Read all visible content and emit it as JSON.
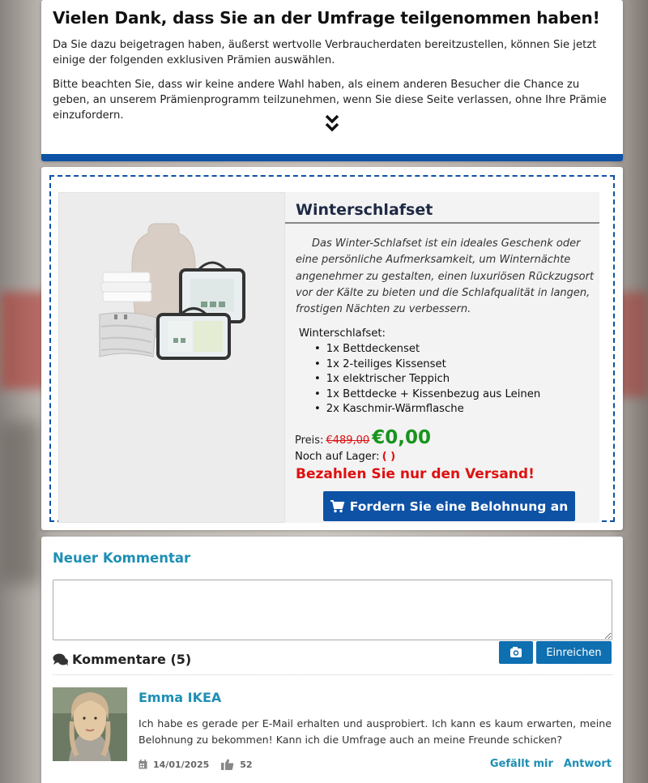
{
  "intro": {
    "title": "Vielen Dank, dass Sie an der Umfrage teilgenommen haben!",
    "paragraph1": "Da Sie dazu beigetragen haben, äußerst wertvolle Verbraucherdaten bereitzustellen, können Sie jetzt einige der folgenden exklusiven Prämien auswählen.",
    "paragraph2": "Bitte beachten Sie, dass wir keine andere Wahl haben, als einem anderen Besucher die Chance zu geben, an unserem Prämienprogramm teilzunehmen, wenn Sie diese Seite verlassen, ohne Ihre Prämie einzufordern.",
    "scroll_icon": "double-chevron-down-icon"
  },
  "offer": {
    "title": "Winterschlafset",
    "description": "Das Winter-Schlafset ist ein ideales Geschenk oder eine persönliche Aufmerksamkeit, um Winternächte angenehmer zu gestalten, einen luxuriösen Rückzugsort vor der Kälte zu bieten und die Schlafqualität in langen, frostigen Nächten zu verbessern.",
    "includes_label": "Winterschlafset:",
    "items": [
      "1x Bettdeckenset",
      "1x 2-teiliges Kissenset",
      "1x elektrischer Teppich",
      "1x Bettdecke + Kissenbezug aus Leinen",
      "2x Kaschmir-Wärmflasche"
    ],
    "price_label": "Preis:",
    "old_price": "€489,00",
    "new_price": "€0,00",
    "stock_label": "Noch auf Lager:",
    "stock_value": "(    )",
    "shipping_note": "Bezahlen Sie nur den Versand!",
    "cta_label": "Fordern Sie eine Belohnung an",
    "cta_icon": "shopping-cart-icon"
  },
  "comments": {
    "new_comment_title": "Neuer Kommentar",
    "submit_label": "Einreichen",
    "camera_icon": "camera-icon",
    "count_label": "Kommentare (5)",
    "list": [
      {
        "author": "Emma IKEA",
        "text": "Ich habe es gerade per E-Mail erhalten und ausprobiert. Ich kann es kaum erwarten, meine Belohnung zu bekommen! Kann ich die Umfrage auch an meine Freunde schicken?",
        "date": "14/01/2025",
        "likes": "52",
        "like_label": "Gefällt mir",
        "reply_label": "Antwort"
      }
    ]
  },
  "colors": {
    "brand_blue": "#0e52a5",
    "link_teal": "#1d8fb4",
    "price_green": "#17941d",
    "alert_red": "#e01010"
  }
}
